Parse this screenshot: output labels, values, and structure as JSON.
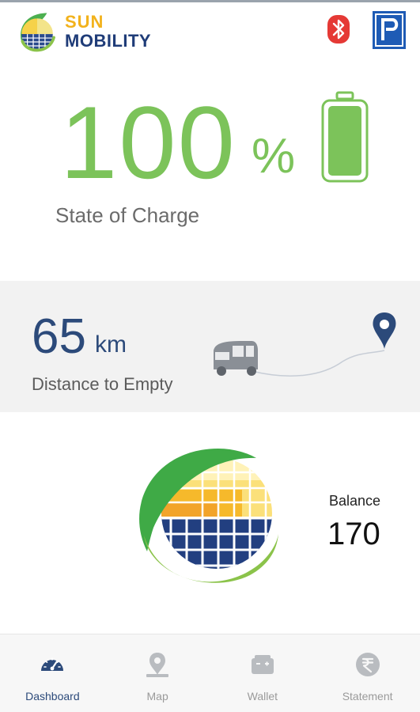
{
  "header": {
    "brand_line1": "SUN",
    "brand_line2": "MOBILITY",
    "bluetooth_icon": "bluetooth-icon",
    "partner_icon": "piaggio-icon"
  },
  "charge": {
    "value": "100",
    "unit": "%",
    "label": "State of Charge",
    "level_fraction": 1.0
  },
  "distance": {
    "value": "65",
    "unit": "km",
    "label": "Distance to Empty"
  },
  "balance": {
    "label": "Balance",
    "value": "170"
  },
  "nav": {
    "items": [
      {
        "label": "Dashboard",
        "icon": "speedometer-icon",
        "active": true
      },
      {
        "label": "Map",
        "icon": "map-pin-icon",
        "active": false
      },
      {
        "label": "Wallet",
        "icon": "wallet-icon",
        "active": false
      },
      {
        "label": "Statement",
        "icon": "rupee-icon",
        "active": false
      }
    ]
  },
  "colors": {
    "accent_green": "#7cc35a",
    "navy": "#2c4a7a",
    "brand_yellow": "#f2b21c"
  }
}
